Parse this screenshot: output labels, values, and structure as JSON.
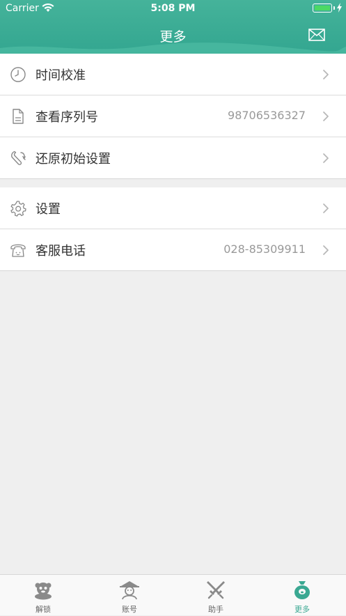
{
  "status_bar": {
    "carrier": "Carrier",
    "time": "5:08 PM",
    "battery_color": "#4cd964"
  },
  "nav": {
    "title": "更多",
    "right_icon": "mail-icon",
    "background_color": "#3aa892"
  },
  "groups": [
    {
      "items": [
        {
          "label": "时间校准",
          "value": "",
          "icon": "clock-icon"
        },
        {
          "label": "查看序列号",
          "value": "98706536327",
          "icon": "document-icon"
        },
        {
          "label": "还原初始设置",
          "value": "",
          "icon": "wrench-icon"
        }
      ]
    },
    {
      "items": [
        {
          "label": "设置",
          "value": "",
          "icon": "gear-icon"
        },
        {
          "label": "客服电话",
          "value": "028-85309911",
          "icon": "telephone-icon"
        }
      ]
    }
  ],
  "tabbar": {
    "active_color": "#3aa892",
    "tabs": [
      {
        "label": "解锁",
        "icon": "unlock-mascot-icon",
        "active": false
      },
      {
        "label": "账号",
        "icon": "account-mascot-icon",
        "active": false
      },
      {
        "label": "助手",
        "icon": "swords-icon",
        "active": false
      },
      {
        "label": "更多",
        "icon": "money-bag-icon",
        "active": true
      }
    ]
  }
}
